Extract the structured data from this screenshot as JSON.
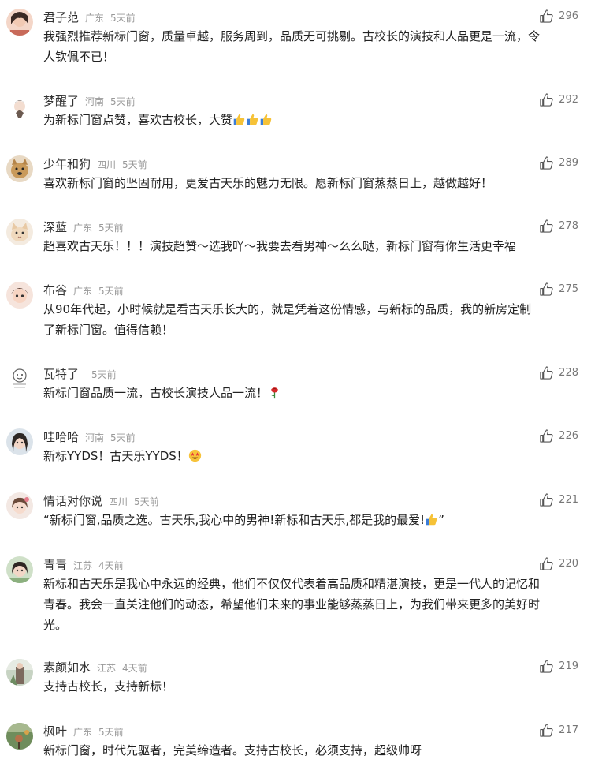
{
  "comments": [
    {
      "name": "君子范",
      "loc": "广东",
      "time": "5天前",
      "likes": "296",
      "text": "我强烈推荐新标门窗，质量卓越，服务周到，品质无可挑剔。古校长的演技和人品更是一流，令\n人钦佩不已！",
      "avatar_color": "#e8b9a7"
    },
    {
      "name": "梦醒了",
      "loc": "河南",
      "time": "5天前",
      "likes": "292",
      "text": "为新标门窗点赞，喜欢古校长，大赞",
      "emoji": "thumbs-up-x3",
      "avatar_color": "#f2f2f2"
    },
    {
      "name": "少年和狗",
      "loc": "四川",
      "time": "5天前",
      "likes": "289",
      "text": "喜欢新标门窗的坚固耐用，更爱古天乐的魅力无限。愿新标门窗蒸蒸日上，越做越好！",
      "avatar_color": "#c9a26e"
    },
    {
      "name": "深蓝",
      "loc": "广东",
      "time": "5天前",
      "likes": "278",
      "text": "超喜欢古天乐！！！演技超赞～选我吖～我要去看男神～么么哒，新标门窗有你生活更幸福",
      "avatar_color": "#efe1cf"
    },
    {
      "name": "布谷",
      "loc": "广东",
      "time": "5天前",
      "likes": "275",
      "text": "从90年代起，小时候就是看古天乐长大的，就是凭着这份情感，与新标的品质，我的新房定制\n了新标门窗。值得信赖！",
      "avatar_color": "#e7c3b3"
    },
    {
      "name": "瓦特了",
      "loc": "",
      "time": "5天前",
      "likes": "228",
      "text": "新标门窗品质一流，古校长演技人品一流！",
      "emoji": "rose",
      "avatar_color": "#ffffff"
    },
    {
      "name": "哇哈哈",
      "loc": "河南",
      "time": "5天前",
      "likes": "226",
      "text": "新标YYDS！古天乐YYDS！",
      "emoji": "star-struck",
      "avatar_color": "#c9d6e0"
    },
    {
      "name": "情话对你说",
      "loc": "四川",
      "time": "5天前",
      "likes": "221",
      "text": "“新标门窗,品质之选。古天乐,我心中的男神!新标和古天乐,都是我的最爱!",
      "emoji": "thumbs-up",
      "text_end": "”",
      "avatar_color": "#e9d7cf"
    },
    {
      "name": "青青",
      "loc": "江苏",
      "time": "4天前",
      "likes": "220",
      "text": "新标和古天乐是我心中永远的经典，他们不仅仅代表着高品质和精湛演技，更是一代人的记忆和\n青春。我会一直关注他们的动态，希望他们未来的事业能够蒸蒸日上，为我们带来更多的美好时\n光。",
      "avatar_color": "#a9c3a0"
    },
    {
      "name": "素颜如水",
      "loc": "江苏",
      "time": "4天前",
      "likes": "219",
      "text": "支持古校长，支持新标！",
      "avatar_color": "#b9c9b8"
    },
    {
      "name": "枫叶",
      "loc": "广东",
      "time": "5天前",
      "likes": "217",
      "text": "新标门窗，时代先驱者，完美缔造者。支持古校长，必须支持，超级帅呀",
      "avatar_color": "#7e9a6a"
    }
  ]
}
